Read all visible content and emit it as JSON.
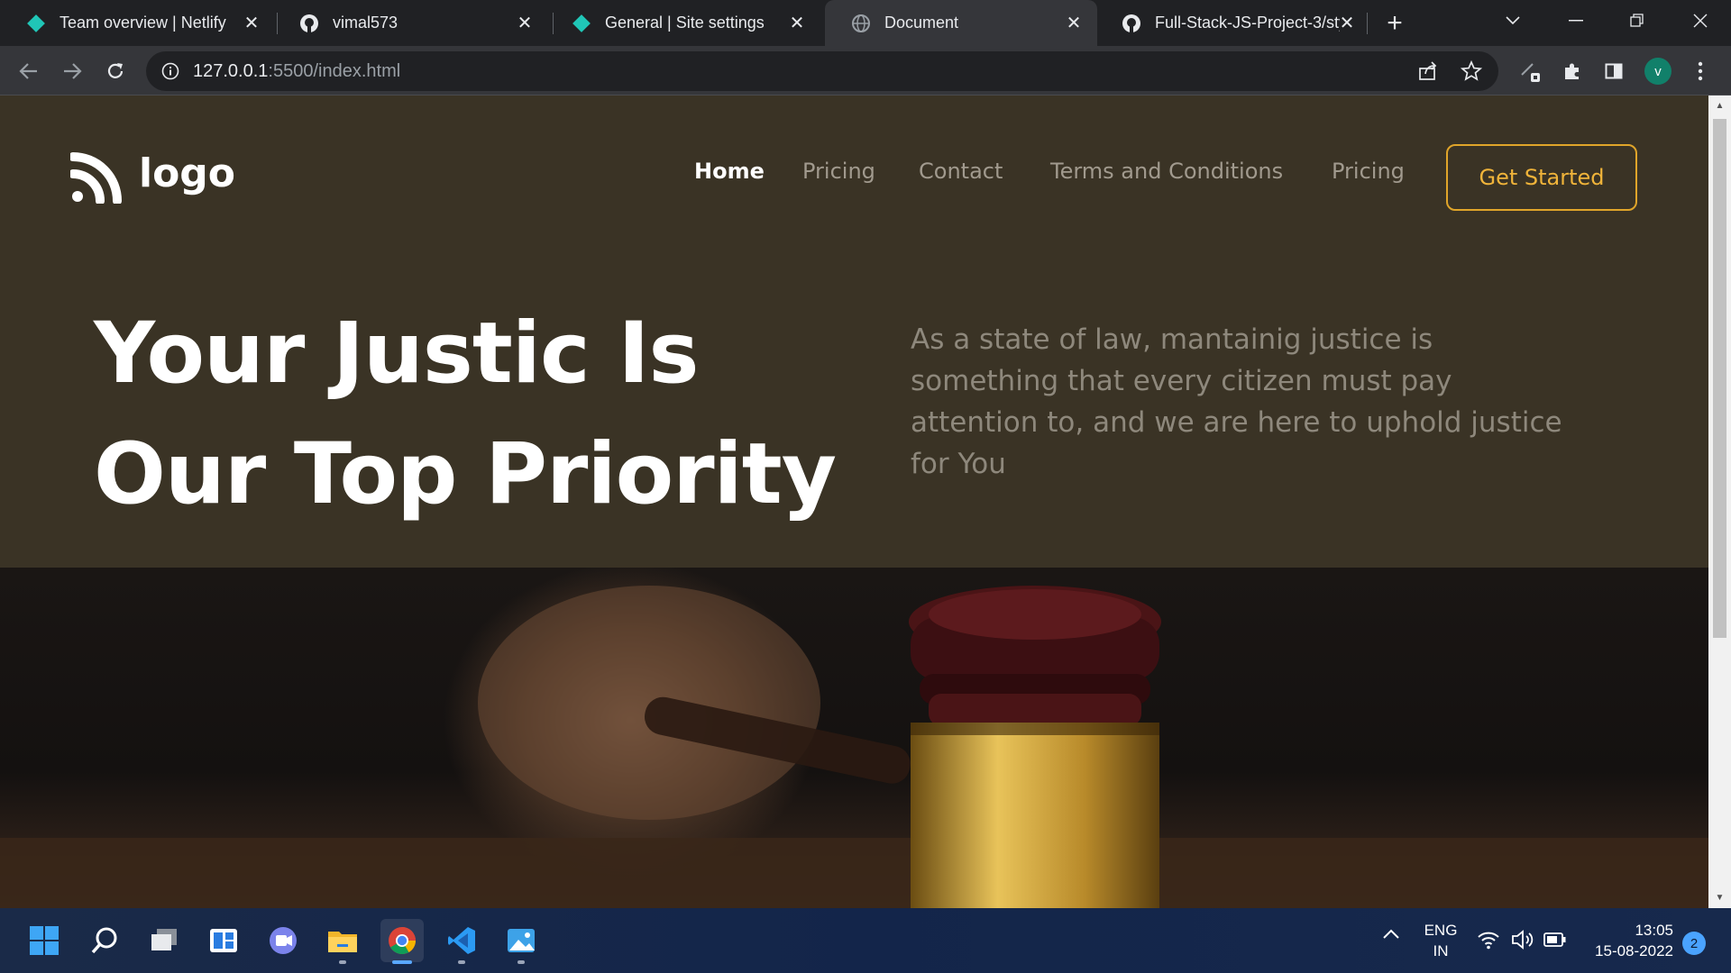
{
  "browser": {
    "tabs": [
      {
        "title": "Team overview | Netlify",
        "icon": "netlify-icon"
      },
      {
        "title": "vimal573",
        "icon": "github-icon"
      },
      {
        "title": "General | Site settings",
        "icon": "netlify-icon"
      },
      {
        "title": "Document",
        "icon": "globe-icon",
        "active": true
      },
      {
        "title": "Full-Stack-JS-Project-3/style",
        "icon": "github-icon"
      }
    ],
    "url_host": "127.0.0.1",
    "url_rest": ":5500/index.html",
    "profile_initial": "v"
  },
  "page": {
    "logo_text": "logo",
    "nav": [
      "Home",
      "Pricing",
      "Contact",
      "Terms and Conditions",
      "Pricing"
    ],
    "cta_label": "Get Started",
    "headline_line1": "Your Justic Is",
    "headline_line2": "Our Top Priority",
    "tagline": "As a state of law, mantainig justice is something that every citizen must pay attention to, and we are here to uphold justice for You",
    "accent_color": "#e0a52a",
    "background_color": "#3a3325"
  },
  "taskbar": {
    "language": "ENG",
    "region": "IN",
    "time": "13:05",
    "date": "15-08-2022",
    "notifications": "2"
  }
}
